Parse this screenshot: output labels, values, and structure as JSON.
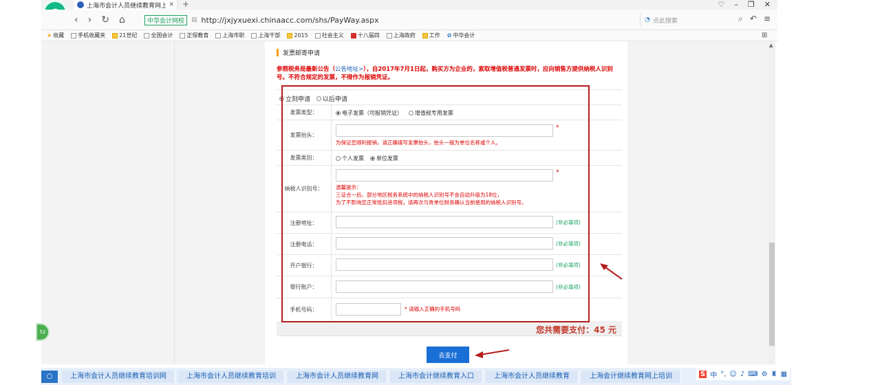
{
  "browser": {
    "tab_title": "上海市会计人员继续教育网上培训",
    "url": "http://jxjyxuexi.chinaacc.com/shs/PayWay.aspx",
    "site_badge": "中华会计网校",
    "search_placeholder": "点此搜索",
    "bookmarks": [
      "收藏",
      "手机收藏夹",
      "21世纪",
      "全国会计",
      "正保教育",
      "上海市职",
      "上海干部",
      "2015",
      "社会主义",
      "十八届四",
      "上海政府",
      "工作",
      "中华会计"
    ]
  },
  "page": {
    "section_title": "发票邮寄申请",
    "notice_a": "参照税务局最新公告（",
    "notice_link": "公告地址>",
    "notice_b": "），自2017年7月1日起，购买方为企业的，索取增值税普通发票时，应向销售方提供纳税人识别号。不符合规定的发票，不得作为报销凭证。",
    "apply_now": "立刻申请",
    "apply_later": "以后申请",
    "fields": {
      "invoice_type_label": "发票类型：",
      "invoice_type_opt1": "电子发票（可报销凭证）",
      "invoice_type_opt2": "增值税专用发票",
      "invoice_title_label": "发票抬头：",
      "invoice_title_hint": "为保证您顺利报销，请正确填写发票抬头，抬头一般为单位名称或个人。",
      "invoice_category_label": "发票类别：",
      "invoice_category_opt1": "个人发票",
      "invoice_category_opt2": "单位发票",
      "taxpayer_id_label": "纳税人识别号：",
      "taxpayer_hint_title": "温馨提示：",
      "taxpayer_hint_1": "三证合一后，部分地区税务系统中的纳税人识别号不会自动升级为18位，",
      "taxpayer_hint_2": "为了不影响您正常抵扣进项税，请再次与贵单位财务确认当前使用的纳税人识别号。",
      "reg_address_label": "注册地址：",
      "reg_phone_label": "注册电话：",
      "bank_label": "开户银行：",
      "account_label": "银行账户：",
      "mobile_label": "手机号码：",
      "optional": "(非必填项)",
      "mobile_hint": "* 请输入正确的手机号码",
      "required_star": "*"
    },
    "total_text": "您共需要支付：45 元",
    "pay_button": "去支付",
    "side_badge": "52"
  },
  "ads": [
    "上海市会计人员继续教育培训网",
    "上海市会计人员继续教育培训",
    "上海市会计人员继续教育网",
    "上海市会计继续教育入口",
    "上海市会计人员继续教育",
    "上海会计继续教育网上培训"
  ],
  "ime": {
    "s": "S",
    "zh": "中"
  }
}
